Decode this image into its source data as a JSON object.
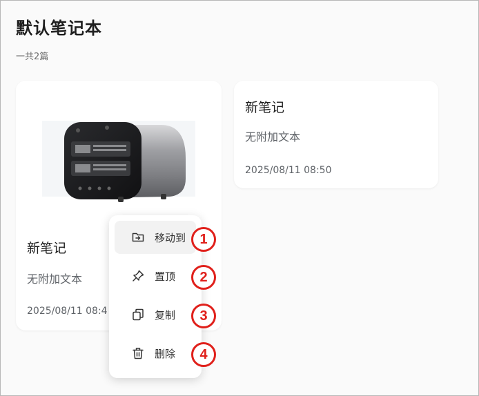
{
  "notebook": {
    "title": "默认笔记本",
    "count_text": "一共2篇"
  },
  "notes": [
    {
      "title": "新笔记",
      "subtitle": "无附加文本",
      "date": "2025/08/11 08:4",
      "has_thumbnail": true
    },
    {
      "title": "新笔记",
      "subtitle": "无附加文本",
      "date": "2025/08/11 08:50",
      "has_thumbnail": false
    }
  ],
  "context_menu": {
    "items": [
      {
        "label": "移动到",
        "icon": "move-to-folder-icon",
        "badge": "1"
      },
      {
        "label": "置顶",
        "icon": "pin-icon",
        "badge": "2"
      },
      {
        "label": "复制",
        "icon": "copy-icon",
        "badge": "3"
      },
      {
        "label": "删除",
        "icon": "trash-icon",
        "badge": "4"
      }
    ]
  },
  "colors": {
    "page_bg": "#fafafa",
    "card_bg": "#ffffff",
    "badge_red": "#e0201b",
    "menu_hover": "#f2f2f2"
  }
}
